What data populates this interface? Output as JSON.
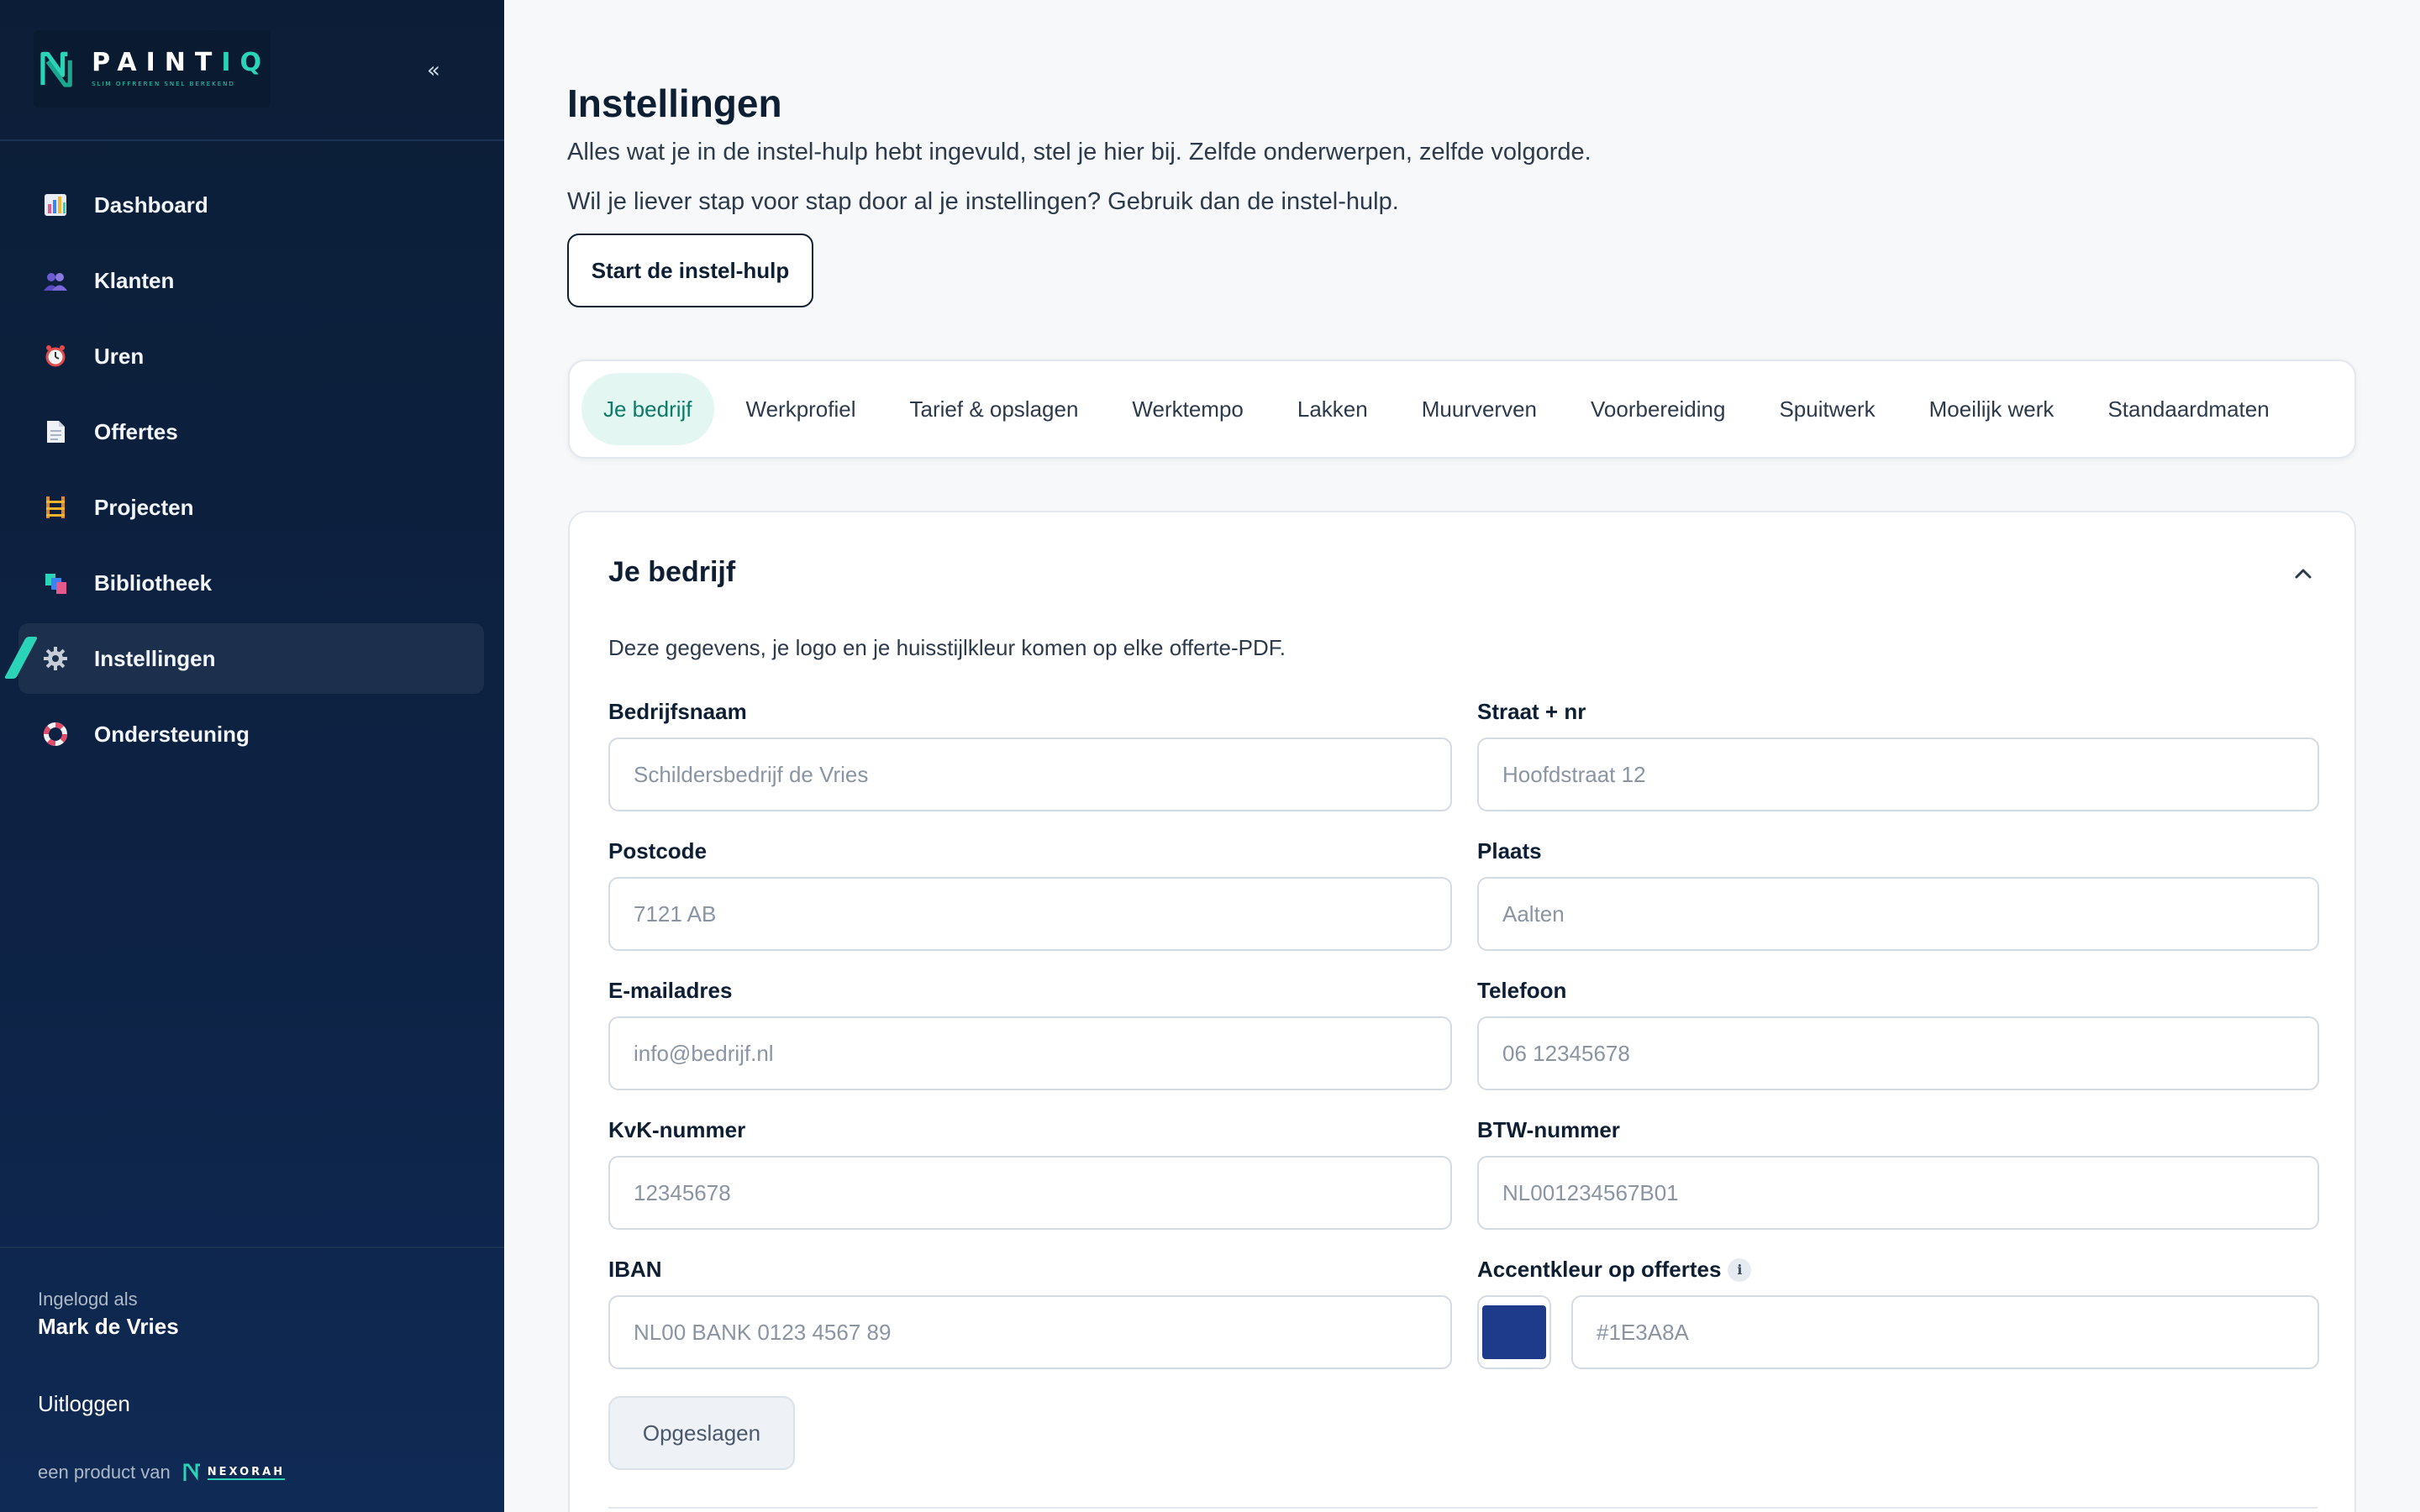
{
  "brand": {
    "name_main": "PAINT",
    "name_accent": "IQ",
    "tagline": "SLIM OFFREREN SNEL BEREKEND",
    "accent_color": "#2bd4b8",
    "sidebar_color": "#0c1e37"
  },
  "sidebar": {
    "collapse_label": "«",
    "items": [
      {
        "label": "Dashboard",
        "icon": "chart-icon"
      },
      {
        "label": "Klanten",
        "icon": "users-icon"
      },
      {
        "label": "Uren",
        "icon": "alarm-clock-icon"
      },
      {
        "label": "Offertes",
        "icon": "document-icon"
      },
      {
        "label": "Projecten",
        "icon": "scaffold-icon"
      },
      {
        "label": "Bibliotheek",
        "icon": "color-swatches-icon"
      },
      {
        "label": "Instellingen",
        "icon": "gear-icon",
        "active": true
      },
      {
        "label": "Ondersteuning",
        "icon": "lifebuoy-icon"
      }
    ],
    "logged_in_label": "Ingelogd als",
    "user_name": "Mark de Vries",
    "logout_label": "Uitloggen",
    "product_of_label": "een product van",
    "company": "NEXORAH"
  },
  "page": {
    "title": "Instellingen",
    "subtitle": "Alles wat je in de instel-hulp hebt ingevuld, stel je hier bij. Zelfde onderwerpen, zelfde volgorde.",
    "wizard_hint": "Wil je liever stap voor stap door al je instellingen? Gebruik dan de instel-hulp.",
    "wizard_button": "Start de instel-hulp"
  },
  "tabs": [
    {
      "label": "Je bedrijf",
      "active": true
    },
    {
      "label": "Werkprofiel"
    },
    {
      "label": "Tarief & opslagen"
    },
    {
      "label": "Werktempo"
    },
    {
      "label": "Lakken"
    },
    {
      "label": "Muurverven"
    },
    {
      "label": "Voorbereiding"
    },
    {
      "label": "Spuitwerk"
    },
    {
      "label": "Moeilijk werk"
    },
    {
      "label": "Standaardmaten"
    }
  ],
  "section": {
    "title": "Je bedrijf",
    "description": "Deze gegevens, je logo en je huisstijlkleur komen op elke offerte-PDF.",
    "fields": {
      "company_name": {
        "label": "Bedrijfsnaam",
        "placeholder": "Schildersbedrijf de Vries"
      },
      "street": {
        "label": "Straat + nr",
        "placeholder": "Hoofdstraat 12"
      },
      "postcode": {
        "label": "Postcode",
        "placeholder": "7121 AB"
      },
      "city": {
        "label": "Plaats",
        "placeholder": "Aalten"
      },
      "email": {
        "label": "E-mailadres",
        "placeholder": "info@bedrijf.nl"
      },
      "phone": {
        "label": "Telefoon",
        "placeholder": "06 12345678"
      },
      "kvk": {
        "label": "KvK-nummer",
        "placeholder": "12345678"
      },
      "btw": {
        "label": "BTW-nummer",
        "placeholder": "NL001234567B01"
      },
      "iban": {
        "label": "IBAN",
        "placeholder": "NL00 BANK 0123 4567 89"
      },
      "accent": {
        "label": "Accentkleur op offertes",
        "info": "i",
        "value": "#1E3A8A"
      }
    },
    "save_label": "Opgeslagen"
  }
}
